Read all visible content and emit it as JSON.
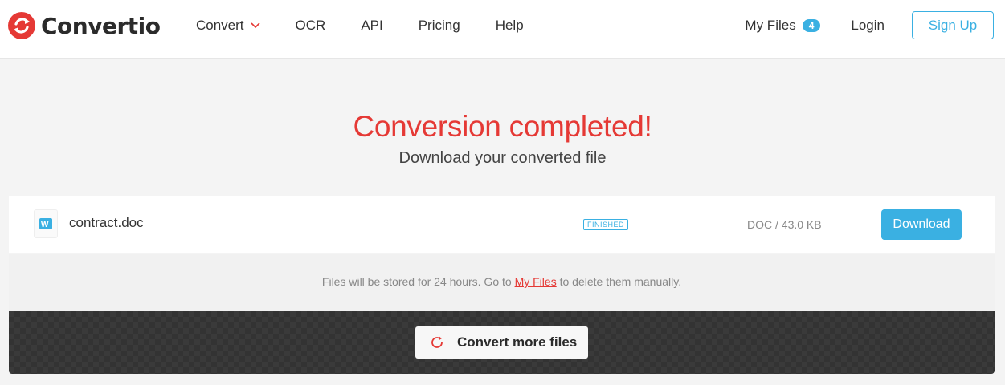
{
  "header": {
    "brand": "Convertio",
    "nav": [
      {
        "label": "Convert",
        "has_dropdown": true
      },
      {
        "label": "OCR"
      },
      {
        "label": "API"
      },
      {
        "label": "Pricing"
      },
      {
        "label": "Help"
      }
    ],
    "my_files_label": "My Files",
    "my_files_count": "4",
    "login_label": "Login",
    "signup_label": "Sign Up"
  },
  "hero": {
    "title": "Conversion completed!",
    "subtitle": "Download your converted file"
  },
  "file": {
    "name": "contract.doc",
    "status": "FINISHED",
    "info": "DOC / 43.0 KB",
    "download_label": "Download",
    "icon": "word-doc-icon"
  },
  "notice": {
    "before": "Files will be stored for 24 hours. Go to ",
    "link": "My Files",
    "after": " to delete them manually."
  },
  "actions": {
    "convert_more_label": "Convert more files"
  },
  "colors": {
    "accent_red": "#e53935",
    "accent_blue": "#3ab0e2",
    "dark_bar": "#3a3a3a"
  }
}
